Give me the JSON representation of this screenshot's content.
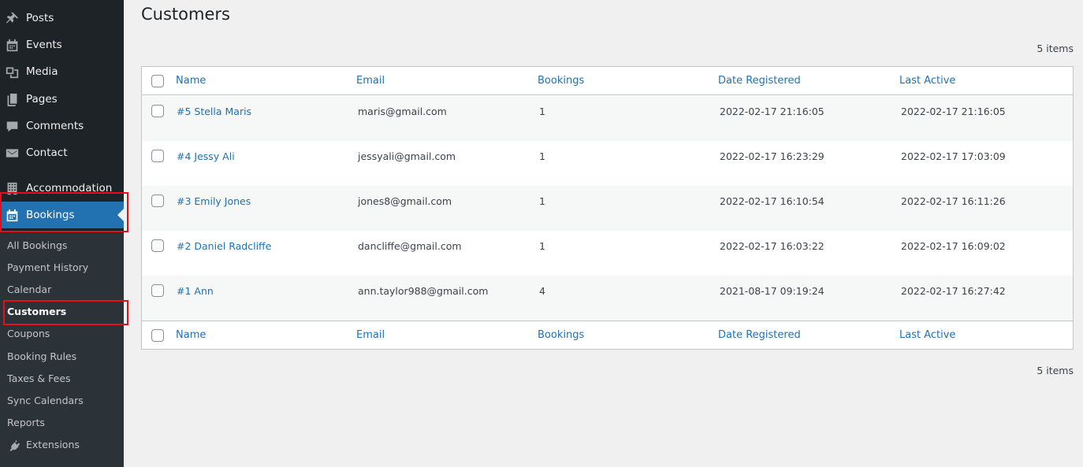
{
  "sidebar": {
    "menu": [
      {
        "label": "Posts",
        "icon": "pin-icon"
      },
      {
        "label": "Events",
        "icon": "calendar-icon"
      },
      {
        "label": "Media",
        "icon": "media-icon"
      },
      {
        "label": "Pages",
        "icon": "pages-icon"
      },
      {
        "label": "Comments",
        "icon": "comment-icon"
      },
      {
        "label": "Contact",
        "icon": "mail-icon"
      },
      {
        "label": "Accommodation",
        "icon": "building-icon"
      },
      {
        "label": "Bookings",
        "icon": "calendar-icon"
      }
    ],
    "submenu": [
      "All Bookings",
      "Payment History",
      "Calendar",
      "Customers",
      "Coupons",
      "Booking Rules",
      "Taxes & Fees",
      "Sync Calendars",
      "Reports",
      "Extensions"
    ]
  },
  "page": {
    "title": "Customers",
    "items_count": "5 items"
  },
  "table": {
    "columns": [
      "Name",
      "Email",
      "Bookings",
      "Date Registered",
      "Last Active"
    ],
    "rows": [
      {
        "name": "#5 Stella Maris",
        "email": "maris@gmail.com",
        "bookings": "1",
        "registered": "2022-02-17 21:16:05",
        "last_active": "2022-02-17 21:16:05"
      },
      {
        "name": "#4 Jessy Ali",
        "email": "jessyali@gmail.com",
        "bookings": "1",
        "registered": "2022-02-17 16:23:29",
        "last_active": "2022-02-17 17:03:09"
      },
      {
        "name": "#3 Emily Jones",
        "email": "jones8@gmail.com",
        "bookings": "1",
        "registered": "2022-02-17 16:10:54",
        "last_active": "2022-02-17 16:11:26"
      },
      {
        "name": "#2 Daniel Radcliffe",
        "email": "dancliffe@gmail.com",
        "bookings": "1",
        "registered": "2022-02-17 16:03:22",
        "last_active": "2022-02-17 16:09:02"
      },
      {
        "name": "#1 Ann",
        "email": "ann.taylor988@gmail.com",
        "bookings": "4",
        "registered": "2021-08-17 09:19:24",
        "last_active": "2022-02-17 16:27:42"
      }
    ]
  },
  "colors": {
    "sidebar_bg": "#1d2327",
    "submenu_bg": "#2c3338",
    "accent": "#2271b1",
    "highlight": "#e3101b"
  }
}
